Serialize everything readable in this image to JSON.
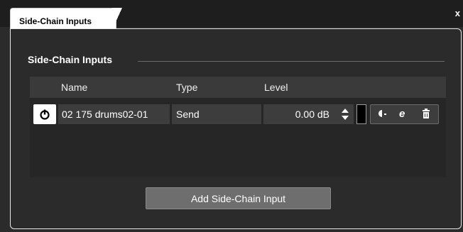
{
  "window": {
    "tab_title": "Side-Chain Inputs",
    "close_label": "x"
  },
  "section": {
    "title": "Side-Chain Inputs"
  },
  "table": {
    "columns": [
      "Name",
      "Type",
      "Level"
    ],
    "rows": [
      {
        "name": "02 175 drums02-01",
        "type": "Send",
        "level": "0.00 dB"
      }
    ]
  },
  "icons": {
    "power": "power-icon",
    "updown": "up-down-arrows-icon",
    "pre_post": "pre-post-icon",
    "edit": "edit-icon",
    "delete": "trash-icon"
  },
  "buttons": {
    "add": "Add Side-Chain Input"
  },
  "colors": {
    "background": "#2b2b2b",
    "header": "#3a3a3a",
    "cell": "#3d3d3d",
    "button": "#6e6e6e"
  }
}
